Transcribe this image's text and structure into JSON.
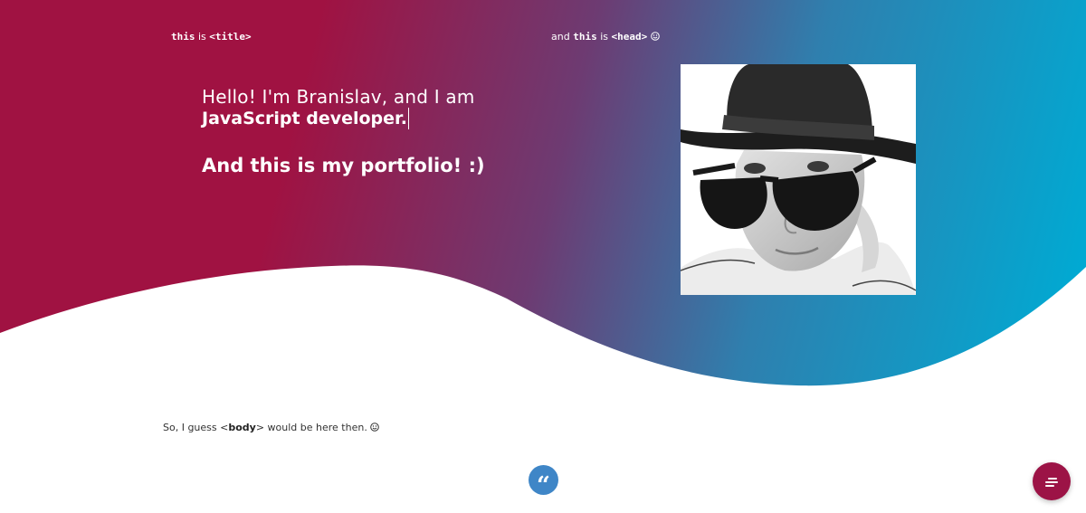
{
  "header": {
    "left_note": {
      "code": "this",
      "text": " is ",
      "tag": "<title>"
    },
    "right_note": {
      "prefix": "and ",
      "code": "this",
      "text": " is ",
      "tag": "<head>"
    }
  },
  "hero": {
    "intro": "Hello! I'm Branislav, and I am",
    "role": "JavaScript developer.",
    "portfolio": "And this is my portfolio! :)"
  },
  "body_note": {
    "prefix": "So, I guess <",
    "tag": "body",
    "suffix": "> would be here then."
  },
  "quote_badge": {
    "glyph": "“"
  },
  "icons": {
    "smiley": "smiley-icon",
    "quote": "quote-icon",
    "menu": "hamburger-menu-icon",
    "portrait": "profile-photo"
  },
  "colors": {
    "crimson": "#a01242",
    "teal": "#00a8d2",
    "quote_blue": "#3f86c7",
    "fab": "#9c1346"
  }
}
